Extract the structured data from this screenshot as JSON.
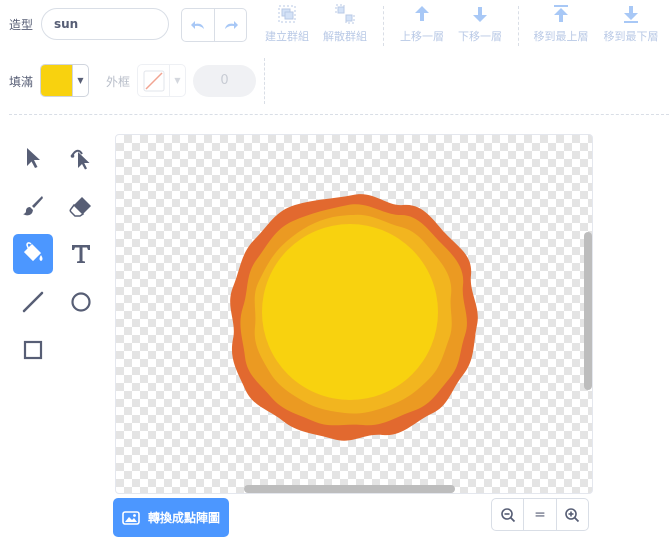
{
  "costume": {
    "label": "造型",
    "name": "sun"
  },
  "toolbar": {
    "group": "建立群組",
    "ungroup": "解散群組",
    "forward": "上移一層",
    "backward": "下移一層",
    "front": "移到最上層",
    "back": "移到最下層"
  },
  "fill": {
    "label": "填滿",
    "color": "#f8d20f"
  },
  "outline": {
    "label": "外框",
    "width": "0"
  },
  "convert_button": {
    "label": "轉換成點陣圖"
  },
  "zoom": {
    "reset_label": "="
  },
  "colors": {
    "accent": "#4c97ff",
    "text": "#575e75"
  }
}
